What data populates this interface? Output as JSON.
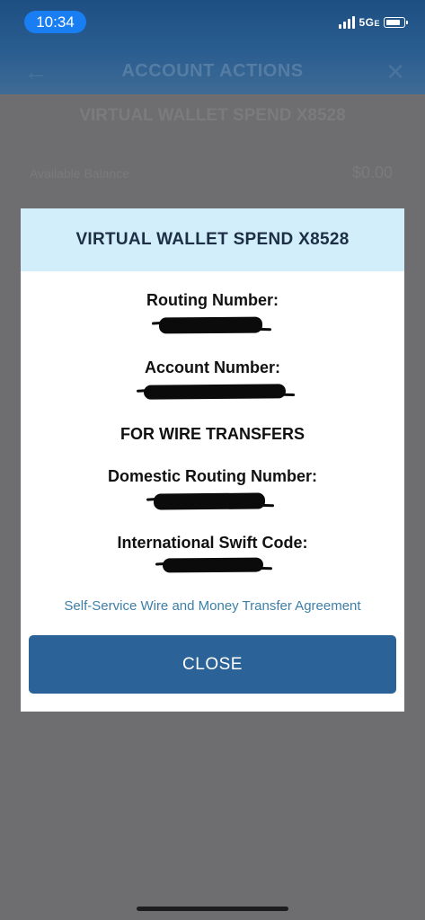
{
  "status_bar": {
    "time": "10:34",
    "network": "5G",
    "network_suffix": "E"
  },
  "nav": {
    "title": "ACCOUNT ACTIONS",
    "back_icon": "arrow-left-icon",
    "close_icon": "close-icon"
  },
  "background": {
    "account_name": "VIRTUAL WALLET SPEND X8528",
    "balance_label": "Available Balance",
    "balance_value": "$0.00"
  },
  "modal": {
    "title": "VIRTUAL WALLET SPEND X8528",
    "routing_label": "Routing Number:",
    "account_label": "Account Number:",
    "wire_heading": "FOR WIRE TRANSFERS",
    "domestic_routing_label": "Domestic Routing Number:",
    "swift_label": "International Swift Code:",
    "agreement_link": "Self-Service Wire and Money Transfer Agreement",
    "close_label": "CLOSE"
  },
  "colors": {
    "header_blue": "#1d4f82",
    "modal_header_bg": "#d2eefb",
    "button_blue": "#2b6398",
    "link_blue": "#3d7fa8",
    "time_pill": "#1a7ef3"
  }
}
